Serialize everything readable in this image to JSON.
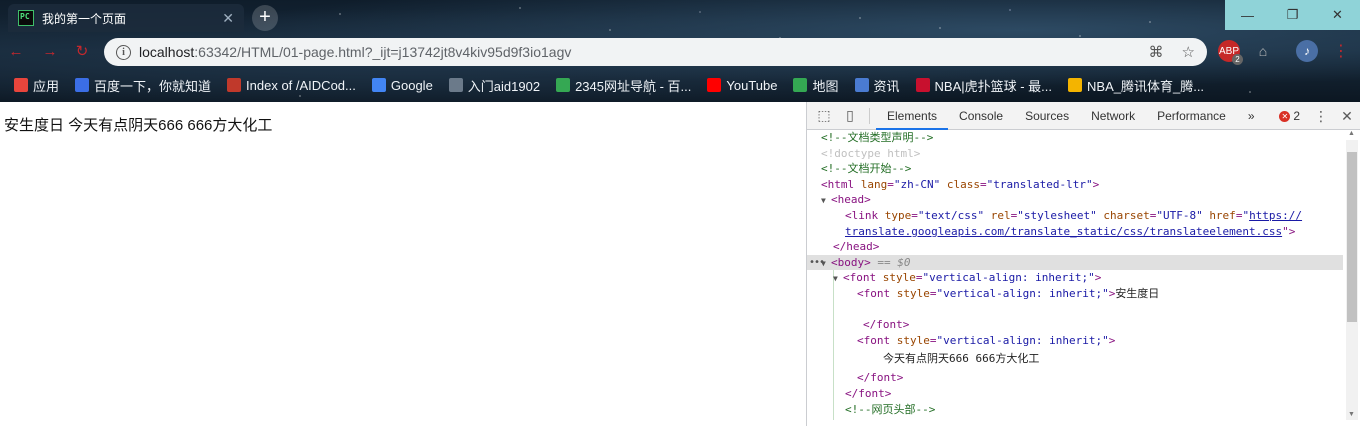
{
  "tab": {
    "favicon": "PC",
    "title": "我的第一个页面",
    "close": "✕"
  },
  "new_tab": "+",
  "window": {
    "minimize": "—",
    "restore": "❐",
    "close": "✕"
  },
  "omnibox": {
    "host": "localhost",
    "rest": ":63342/HTML/01-page.html?_ijt=j13742jt8v4kiv95d9f3io1agv"
  },
  "extensions": {
    "abp_badge": "2"
  },
  "bookmarks": [
    {
      "label": "应用",
      "icon": "apps-grid-icon",
      "color": "#e8453c"
    },
    {
      "label": "百度一下，你就知道",
      "icon": "baidu-paw-icon",
      "color": "#3b6ee6"
    },
    {
      "label": "Index of /AIDCod...",
      "icon": "page-icon",
      "color": "#c0392b"
    },
    {
      "label": "Google",
      "icon": "google-icon",
      "color": "#4285f4"
    },
    {
      "label": "入门aid1902",
      "icon": "blank-icon",
      "color": "#6b7a8a"
    },
    {
      "label": "2345网址导航 - 百...",
      "icon": "house-icon",
      "color": "#35a853"
    },
    {
      "label": "YouTube",
      "icon": "youtube-icon",
      "color": "#ff0000"
    },
    {
      "label": "地图",
      "icon": "maps-icon",
      "color": "#34a853"
    },
    {
      "label": "资讯",
      "icon": "news-icon",
      "color": "#4a7bd1"
    },
    {
      "label": "NBA|虎扑篮球 - 最...",
      "icon": "hupu-icon",
      "color": "#c8102e"
    },
    {
      "label": "NBA_腾讯体育_腾...",
      "icon": "tencent-icon",
      "color": "#f4b400"
    }
  ],
  "page": {
    "text": "安生度日 今天有点阴天666 666方大化工"
  },
  "devtools": {
    "tabs": [
      "Elements",
      "Console",
      "Sources",
      "Network",
      "Performance"
    ],
    "active_tab": "Elements",
    "more": "»",
    "error_count": "2",
    "lines": {
      "l1": "<!--文档类型声明-->",
      "l2": "<!doctype html>",
      "l3": "<!--文档开始-->",
      "l4_tag": "<html ",
      "l4_a1": "lang",
      "l4_v1": "\"zh-CN\"",
      "l4_a2": "class",
      "l4_v2": "\"translated-ltr\"",
      "l4_end": ">",
      "l5": "<head>",
      "l6_tag": "<link ",
      "l6_a1": "type",
      "l6_v1": "\"text/css\"",
      "l6_a2": "rel",
      "l6_v2": "\"stylesheet\"",
      "l6_a3": "charset",
      "l6_v3": "\"UTF-8\"",
      "l6_a4": "href",
      "l6_q": "\"",
      "l6_link1": "https://",
      "l7_link2": "translate.googleapis.com/translate_static/css/translateelement.css",
      "l7_end": "\">",
      "l8": "</head>",
      "l9_tag": "<body>",
      "l9_eq": " == $0",
      "l10_tag": "<font ",
      "l10_a": "style",
      "l10_v": "\"vertical-align: inherit;\"",
      "l10_end": ">",
      "l11_text": "安生度日",
      "l12": "</font>",
      "l14_text": "今天有点阴天666  666方大化工",
      "l15": "</font>",
      "l16": "</font>",
      "l17": "<!--网页头部-->"
    }
  }
}
